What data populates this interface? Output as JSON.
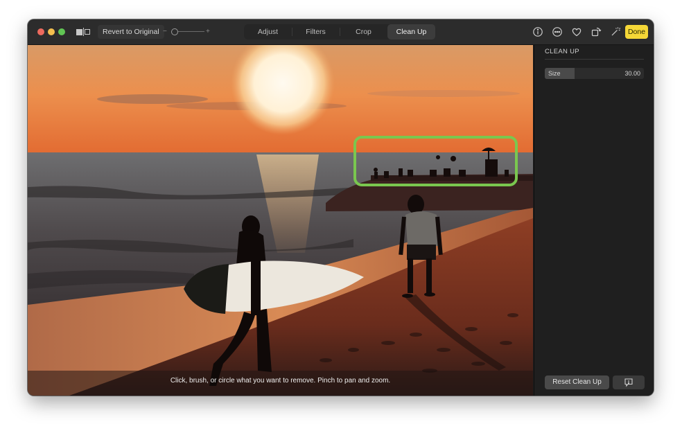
{
  "window": {
    "traffic_lights": {
      "close": "#ed6a5e",
      "minimize": "#f4bf4f",
      "maximize": "#61c554"
    }
  },
  "toolbar": {
    "compare_icon": "before-after-compare-icon",
    "revert_label": "Revert to Original",
    "zoom_minus": "−",
    "zoom_plus": "+",
    "zoom_level": 0,
    "tabs": [
      {
        "label": "Adjust",
        "active": false
      },
      {
        "label": "Filters",
        "active": false
      },
      {
        "label": "Crop",
        "active": false
      },
      {
        "label": "Clean Up",
        "active": true
      }
    ],
    "right_icons": [
      "info-icon",
      "more-icon",
      "heart-icon",
      "rotate-icon",
      "magic-wand-icon"
    ],
    "done_label": "Done",
    "done_color": "#f5d737"
  },
  "photo": {
    "description": "Beach at sunset with surfer carrying surfboard and a man standing; distant people on a rocky outcrop are circled with a green selection",
    "selection_color": "#7ac74f",
    "hint_text": "Click, brush, or circle what you want to remove. Pinch to pan and zoom."
  },
  "sidebar": {
    "section_title": "CLEAN UP",
    "size_label": "Size",
    "size_value": "30.00",
    "size_fraction": 0.3,
    "reset_label": "Reset Clean Up",
    "feedback_icon": "feedback-icon"
  }
}
